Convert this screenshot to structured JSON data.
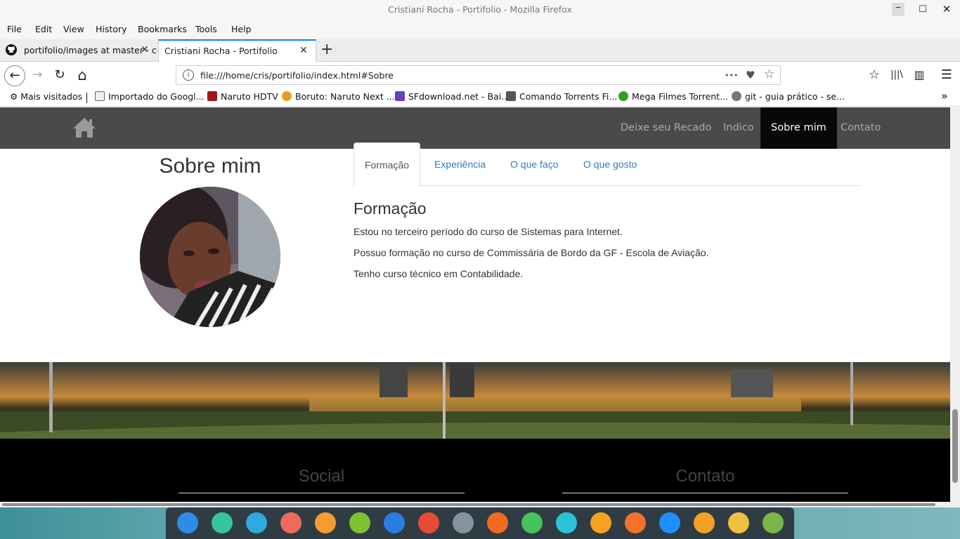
{
  "window": {
    "title": "Cristiani Rocha - Portifolio - Mozilla Firefox",
    "min": "‒",
    "max": "☐",
    "close": "✕"
  },
  "menu": [
    "File",
    "Edit",
    "View",
    "History",
    "Bookmarks",
    "Tools",
    "Help"
  ],
  "tabs": [
    {
      "title": "portifolio/images at master · cr",
      "close": "✕"
    },
    {
      "title": "Cristiani Rocha - Portifolio",
      "close": "✕"
    }
  ],
  "newtab": "+",
  "nav": {
    "back": "←",
    "forward": "→",
    "reload": "↻",
    "home": "⌂",
    "info": "i",
    "url": "file:///home/cris/portifolio/index.html#Sobre",
    "more": "•••",
    "pocket": "♥",
    "star": "☆",
    "toolbar_star": "☆",
    "library": "|||\\",
    "sidebar": "▥",
    "menu": "☰"
  },
  "bookmarks": [
    {
      "label": "Mais visitados",
      "color": "#444"
    },
    {
      "label": "Importado do Googl...",
      "color": "#c9a34a"
    },
    {
      "label": "Naruto HDTV",
      "color": "#a0181c"
    },
    {
      "label": "Boruto: Naruto Next ...",
      "color": "#e0a020"
    },
    {
      "label": "SFdownload.net - Bai...",
      "color": "#6a3fb5"
    },
    {
      "label": "Comando Torrents Fi...",
      "color": "#555"
    },
    {
      "label": "Mega Filmes Torrent...",
      "color": "#3a9a2a"
    },
    {
      "label": "git - guia prático - se...",
      "color": "#777"
    }
  ],
  "bookmarks_overflow": "»",
  "site": {
    "nav": [
      "Deixe seu Recado",
      "Indico",
      "Sobre mim",
      "Contato"
    ],
    "about_title": "Sobre mim",
    "tabs": [
      "Formação",
      "Experiência",
      "O que faço",
      "O que gosto"
    ],
    "section_title": "Formação",
    "paragraphs": [
      "Estou no terceiro período do curso de Sistemas para Internet.",
      "Possuo formação no curso de Commissária de Bordo da GF - Escola de Aviação.",
      "Tenho curso técnico em Contabilidade."
    ],
    "footer": {
      "social": "Social",
      "contact": "Contato"
    }
  },
  "dock": {
    "colors": [
      "#2d8de6",
      "#36c3a0",
      "#2fa9e0",
      "#ee6b5b",
      "#f59b32",
      "#7ec22f",
      "#2a7de1",
      "#e44c33",
      "#8893a0",
      "#f06a21",
      "#45c35a",
      "#2ac2d6",
      "#f7a21e",
      "#f2712c",
      "#1e90ff",
      "#f4a024",
      "#f0c040",
      "#7ab648"
    ],
    "names": [
      "launcher-icon",
      "terminal-icon",
      "file-manager-icon",
      "screen-recorder-icon",
      "app-store-icon",
      "music-icon",
      "video-icon",
      "chrome-icon",
      "settings-icon",
      "firefox-icon",
      "phone-icon",
      "whatsapp-icon",
      "chat-icon",
      "install-icon",
      "wifi-icon",
      "power-icon",
      "clock-icon",
      "trash-icon"
    ]
  }
}
